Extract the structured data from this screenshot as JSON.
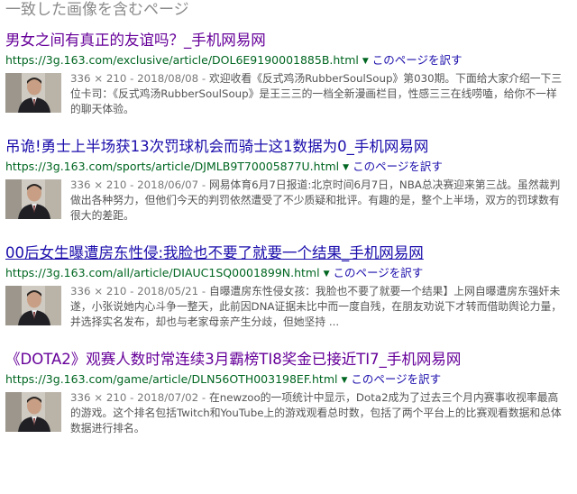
{
  "header": {
    "title": "一致した画像を含むページ"
  },
  "results": [
    {
      "title": "男女之间有真正的友谊吗？_手机网易网",
      "url": "https://3g.163.com/exclusive/article/DOL6E9190001885B.html",
      "similar_label": "このページを訳す",
      "meta": "336 × 210 - 2018/08/08 - ",
      "snippet": "欢迎收看《反式鸡汤RubberSoulSoup》第030期。下面给大家介绍一下三位卡司：《反式鸡汤RubberSoulSoup》是王三三的一档全新漫画栏目，性感三三在线唠嗑，给你不一样的聊天体验。"
    },
    {
      "title": "吊诡!勇士上半场获13次罚球机会而骑士这1数据为0_手机网易网",
      "url": "https://3g.163.com/sports/article/DJMLB9T70005877U.html",
      "similar_label": "このページを訳す",
      "meta": "336 × 210 - 2018/06/07 - ",
      "snippet": "网易体育6月7日报道:北京时间6月7日，NBA总决赛迎来第三战。虽然裁判做出各种努力，但他们今天的判罚依然遭受了不少质疑和批评。有趣的是，整个上半场，双方的罚球数有很大的差距。"
    },
    {
      "title": "00后女生曝遭房东性侵:我脸也不要了就要一个结果_手机网易网",
      "url": "https://3g.163.com/all/article/DIAUC1SQ0001899N.html",
      "similar_label": "このページを訳す",
      "meta": "336 × 210 - 2018/05/21 - ",
      "snippet": "自曝遭房东性侵女孩：我脸也不要了就要一个结果】上网自曝遭房东强奸未遂，小张说她内心斗争一整天，此前因DNA证据未比中而一度自残，在朋友劝说下才转而借助舆论力量，并选择实名发布，却也与老家母亲产生分歧，但她坚持 ..."
    },
    {
      "title": "《DOTA2》观赛人数时常连续3月霸榜TI8奖金已接近TI7_手机网易网",
      "url": "https://3g.163.com/game/article/DLN56OTH003198EF.html",
      "similar_label": "このページを訳す",
      "meta": "336 × 210 - 2018/07/02 - ",
      "snippet": "在newzoo的一项统计中显示，Dota2成为了过去三个月内赛事收视率最高的游戏。这个排名包括Twitch和YouTube上的游戏观看总时数，包括了两个平台上的比赛观看数据和总体数据进行排名。"
    }
  ]
}
